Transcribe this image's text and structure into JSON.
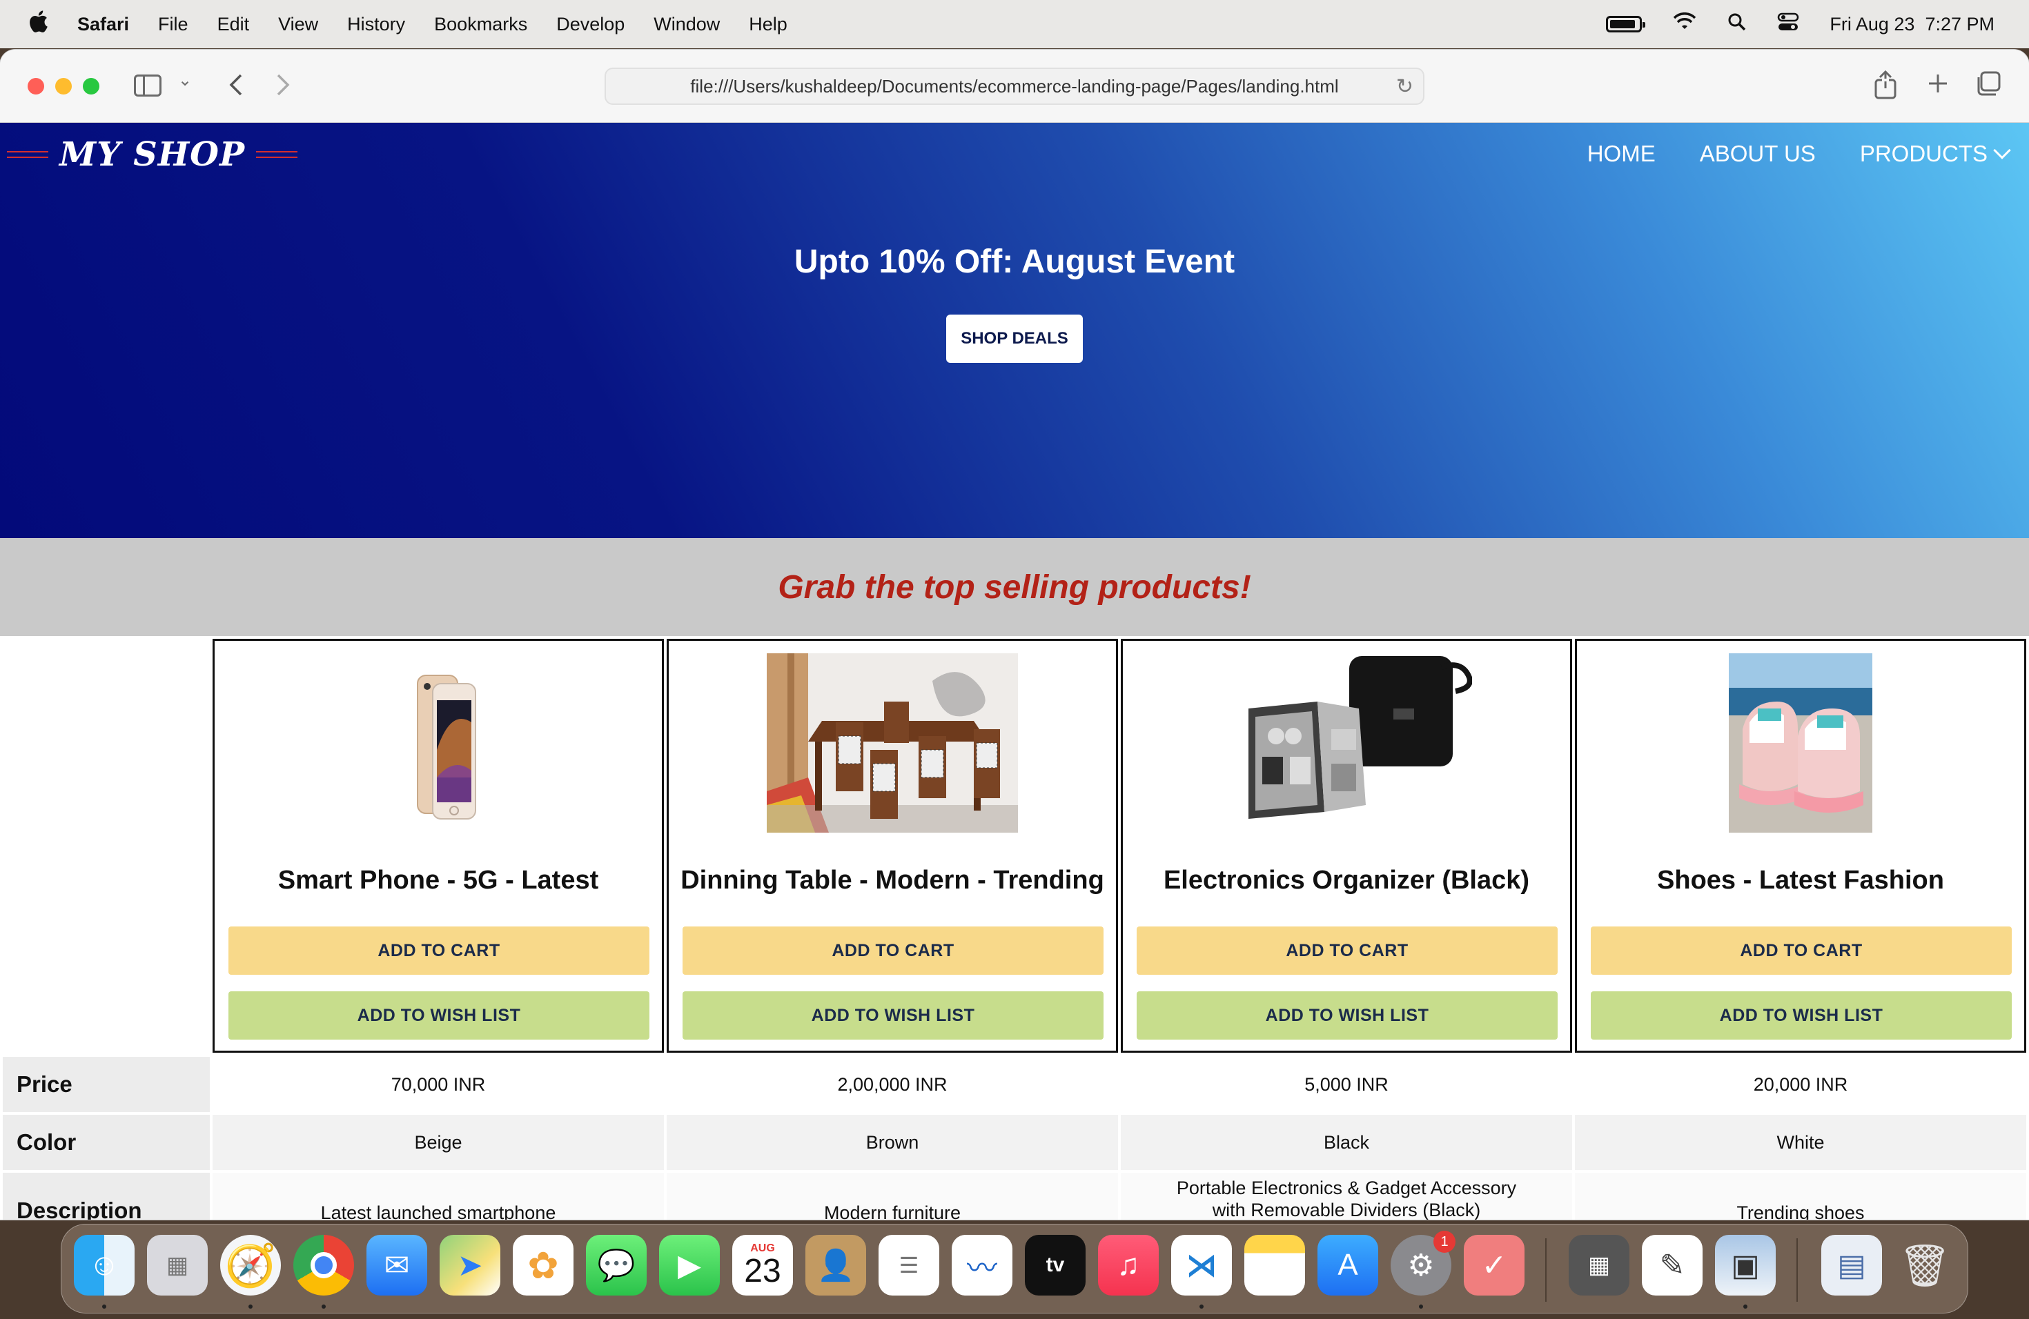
{
  "menubar": {
    "app_name": "Safari",
    "menus": [
      "File",
      "Edit",
      "View",
      "History",
      "Bookmarks",
      "Develop",
      "Window",
      "Help"
    ],
    "date": "Fri Aug 23",
    "time": "7:27 PM",
    "battery_level": 0.9
  },
  "browser": {
    "url": "file:///Users/kushaldeep/Documents/ecommerce-landing-page/Pages/landing.html"
  },
  "page": {
    "logo": "MY SHOP",
    "nav": {
      "home": "HOME",
      "about": "ABOUT US",
      "products": "PRODUCTS"
    },
    "hero": {
      "title": "Upto 10% Off: August Event",
      "cta": "SHOP DEALS"
    },
    "banner": "Grab the top selling products!",
    "buttons": {
      "add_to_cart": "ADD TO CART",
      "add_to_wish_list": "ADD TO WISH LIST"
    },
    "products": [
      {
        "name": "Smart Phone - 5G - Latest",
        "price": "70,000 INR",
        "color": "Beige",
        "description": "Latest launched smartphone"
      },
      {
        "name": "Dinning Table - Modern - Trending",
        "price": "2,00,000 INR",
        "color": "Brown",
        "description": "Modern furniture"
      },
      {
        "name": "Electronics Organizer (Black)",
        "price": "5,000 INR",
        "color": "Black",
        "description": "Portable Electronics & Gadget Accessory with Removable Dividers (Black)"
      },
      {
        "name": "Shoes - Latest Fashion",
        "price": "20,000 INR",
        "color": "White",
        "description": "Trending shoes"
      }
    ],
    "spec_labels": {
      "price": "Price",
      "color": "Color",
      "description": "Description"
    }
  },
  "dock": {
    "calendar_month": "AUG",
    "calendar_day": "23",
    "settings_badge": "1",
    "apps": [
      "finder-icon",
      "launchpad-icon",
      "safari-icon",
      "chrome-icon",
      "mail-icon",
      "maps-icon",
      "photos-icon",
      "messages-icon",
      "facetime-icon",
      "calendar-icon",
      "contacts-icon",
      "reminders-icon",
      "freeform-icon",
      "appletv-icon",
      "music-icon",
      "vscode-icon",
      "notes-icon",
      "appstore-icon",
      "settings-icon",
      "todo-icon",
      "calculator-icon",
      "textedit-icon",
      "preview-icon",
      "documents-icon",
      "trash-icon"
    ]
  }
}
